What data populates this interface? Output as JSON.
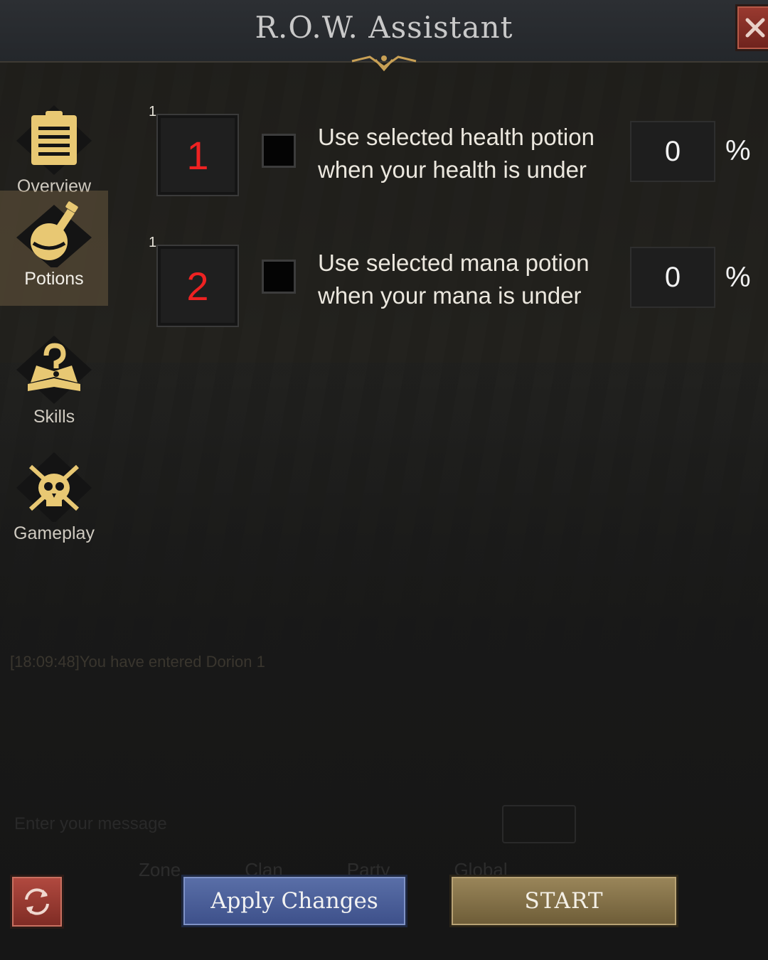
{
  "window": {
    "title": "R.O.W. Assistant"
  },
  "sidebar": {
    "items": [
      {
        "label": "Overview",
        "icon": "clipboard-icon",
        "active": false
      },
      {
        "label": "Potions",
        "icon": "potion-flask-icon",
        "active": true
      },
      {
        "label": "Skills",
        "icon": "question-book-icon",
        "active": false
      },
      {
        "label": "Gameplay",
        "icon": "skull-swords-icon",
        "active": false
      }
    ]
  },
  "potions": {
    "health": {
      "slot_count": "1",
      "slot_marker": "1",
      "line1": "Use selected health potion",
      "line2": "when your health is under",
      "value": "0",
      "unit": "%",
      "checked": false
    },
    "mana": {
      "slot_count": "1",
      "slot_marker": "2",
      "line1": "Use selected mana potion",
      "line2": "when your mana is under",
      "value": "0",
      "unit": "%",
      "checked": false
    }
  },
  "background": {
    "chat_line": "[18:09:48]You have entered Dorion 1",
    "chat_placeholder": "Enter your message",
    "chat_tabs": [
      "Zone",
      "Clan",
      "Party",
      "Global"
    ]
  },
  "footer": {
    "apply_label": "Apply Changes",
    "start_label": "START"
  },
  "colors": {
    "accent_gold": "#c8a055",
    "marker_red": "#ee2222",
    "apply_blue": "#4a5e98",
    "start_gold": "#8a7548",
    "close_red": "#8a3028"
  }
}
